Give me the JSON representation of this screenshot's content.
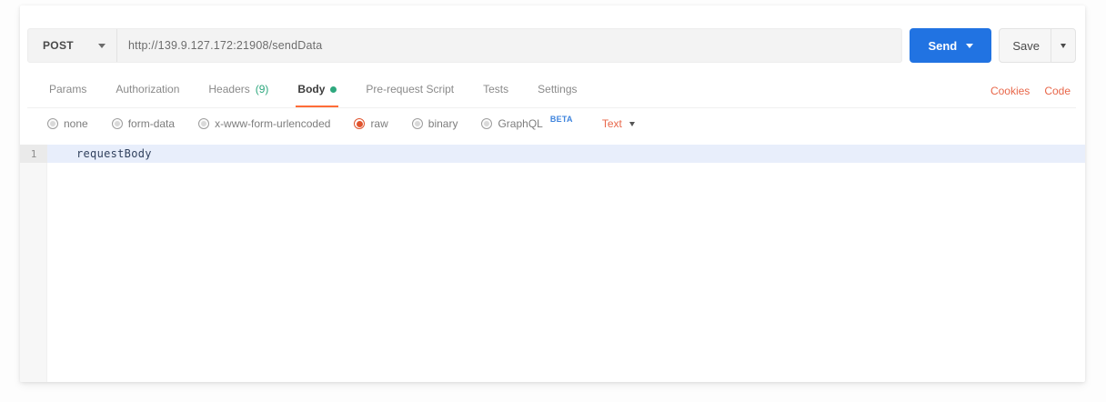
{
  "request_bar": {
    "method": "POST",
    "url": "http://139.9.127.172:21908/sendData",
    "send_label": "Send",
    "save_label": "Save"
  },
  "tabs": [
    {
      "label": "Params"
    },
    {
      "label": "Authorization"
    },
    {
      "label": "Headers",
      "count": "(9)"
    },
    {
      "label": "Body",
      "active": true
    },
    {
      "label": "Pre-request Script"
    },
    {
      "label": "Tests"
    },
    {
      "label": "Settings"
    }
  ],
  "side_links": {
    "cookies": "Cookies",
    "code": "Code"
  },
  "body_types": [
    {
      "label": "none"
    },
    {
      "label": "form-data"
    },
    {
      "label": "x-www-form-urlencoded"
    },
    {
      "label": "raw",
      "selected": true
    },
    {
      "label": "binary"
    },
    {
      "label": "GraphQL",
      "beta": "BETA"
    }
  ],
  "format_select": {
    "value": "Text"
  },
  "editor": {
    "lines": [
      {
        "number": "1",
        "text": "requestBody"
      }
    ]
  },
  "colors": {
    "accent_orange": "#ff6c37",
    "link_orange": "#e8674a",
    "send_blue": "#2173e2",
    "success_green": "#2ea87e",
    "beta_blue": "#3f84dd",
    "active_line_bg": "#e8eefb"
  }
}
